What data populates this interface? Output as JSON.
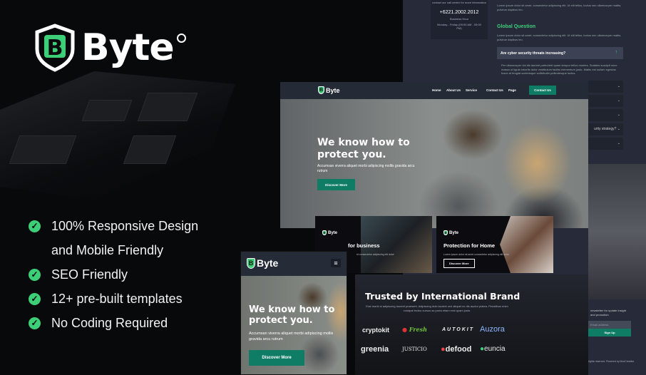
{
  "brand": {
    "name": "Byte",
    "icon_letter": "B",
    "accent": "#3ccf78",
    "button_color": "#0f7d66"
  },
  "features": [
    {
      "icon": "check-circle-icon",
      "label": "100% Responsive Design"
    },
    {
      "icon": "",
      "label": "and Mobile Friendly"
    },
    {
      "icon": "check-circle-icon",
      "label": "SEO Friendly"
    },
    {
      "icon": "check-circle-icon",
      "label": "12+ pre-built templates"
    },
    {
      "icon": "check-circle-icon",
      "label": "No Coding Required"
    }
  ],
  "faq_page": {
    "contact_text": "contact our call center for more information",
    "phone": "+6221.2002.2012",
    "hours_label": "Business Hour",
    "hours": "Monday - Friday (09:00 AM - 05:00 PM)",
    "lorem": "Lorem ipsum dolor sit amet, consectetur adipiscing elit. Ut elit tellus, luctus nec ullamcorper mattis, pulvinar dapibus leo.",
    "section_title": "Global Question",
    "open_question": "Are cyber security threats increasing?",
    "open_answer": "Per ullamcorper dui dis laoreet parturient quam tempor tellus montes. Sodales suscipit nunc massa ut ligula lobortis dolor vestibulum facilisi elementum justo. Mattis est nullam egestas fusce at feugiat scelerisque sollicitudin pellentesque luctus.",
    "partial_question": "urity strategy?",
    "newsletter_text": "newsletter for update insight and promotion",
    "email_placeholder": "Email address",
    "signup": "Sign Up",
    "copyright": "rights reserved. Powered by MoxCreative."
  },
  "desktop": {
    "nav": [
      "Home",
      "About Us",
      "Service",
      "Contact Us",
      "Page"
    ],
    "nav_cta": "Contact Us",
    "hero_title_1": "We know how to",
    "hero_title_2": "protect you.",
    "hero_sub": "Accumsan viverra aliquet morbi adipiscing mollis gravida arcu rutrum",
    "hero_cta": "Discover More"
  },
  "cards": [
    {
      "title": "for business",
      "desc": "et consectetur adipiscing elit dolor"
    },
    {
      "title": "Protection for Home",
      "desc": "Lorem ipsum dolor sit amet consectetur adipiscing elit dolor",
      "cta": "Discover More"
    }
  ],
  "trusted": {
    "title": "Trusted by International Brand",
    "desc": "Erat morbi si adipiscing laoreet praesent. Adipiscing duis laoreet orci aliquet ex dis auctor platea. Penatibus enim volutpat lectus cursus ac porta etiam erat quam justo.",
    "brands": [
      "cryptokit",
      "Fresh",
      "AUTOKIT",
      "Auzora",
      "greenia",
      "JUSTICIO",
      "defood",
      "euncia"
    ]
  },
  "mobile": {
    "hero_title_1": "We know how to",
    "hero_title_2": "protect you.",
    "hero_sub": "Accumsan viverra aliquet morbi adipiscing mollis gravida arcu rutrum",
    "hero_cta": "Discover More"
  }
}
